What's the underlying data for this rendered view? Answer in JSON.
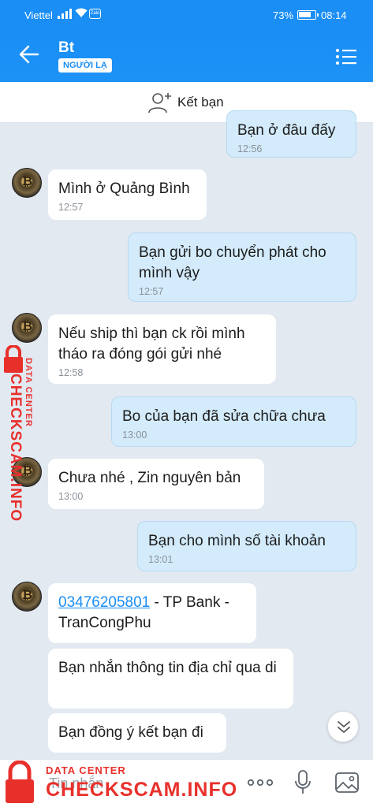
{
  "status_bar": {
    "carrier": "Viettel",
    "battery": "73%",
    "time": "08:14",
    "app_badge": "Zalo"
  },
  "header": {
    "contact_name": "Bt",
    "badge": "NGƯỜI LẠ"
  },
  "add_friend": {
    "label": "Kết bạn"
  },
  "messages": [
    {
      "direction": "out",
      "text": "Bạn ở đâu đấy",
      "time": "12:56"
    },
    {
      "direction": "in",
      "text": "Mình ở Quảng Bình",
      "time": "12:57"
    },
    {
      "direction": "out",
      "text": "Bạn gửi bo chuyển phát cho mình vậy",
      "time": "12:57"
    },
    {
      "direction": "in",
      "text": "Nếu ship thì bạn ck rồi mình tháo ra đóng gói gửi nhé",
      "time": "12:58"
    },
    {
      "direction": "out",
      "text": "Bo của bạn đã sửa chữa chưa",
      "time": "13:00"
    },
    {
      "direction": "in",
      "text": "Chưa nhé , Zin nguyên bản",
      "time": "13:00"
    },
    {
      "direction": "out",
      "text": "Bạn cho mình số tài khoản",
      "time": "13:01"
    },
    {
      "direction": "in",
      "link": "03476205801",
      "text": " - TP Bank - TranCongPhu"
    },
    {
      "direction": "in",
      "text": "Bạn nhắn thông tin địa chỉ qua di"
    },
    {
      "direction": "in",
      "text": "Bạn đồng ý kết bạn đi"
    }
  ],
  "input": {
    "placeholder": "Tin nhắn"
  },
  "watermark": {
    "line1": "DATA CENTER",
    "line2": "CHECKSCAM.INFO"
  },
  "colors": {
    "header_blue": "#1a8ef5",
    "outgoing_bubble": "#d3ebfb",
    "chat_bg": "#e2e9f1",
    "watermark_red": "#e8302b"
  }
}
